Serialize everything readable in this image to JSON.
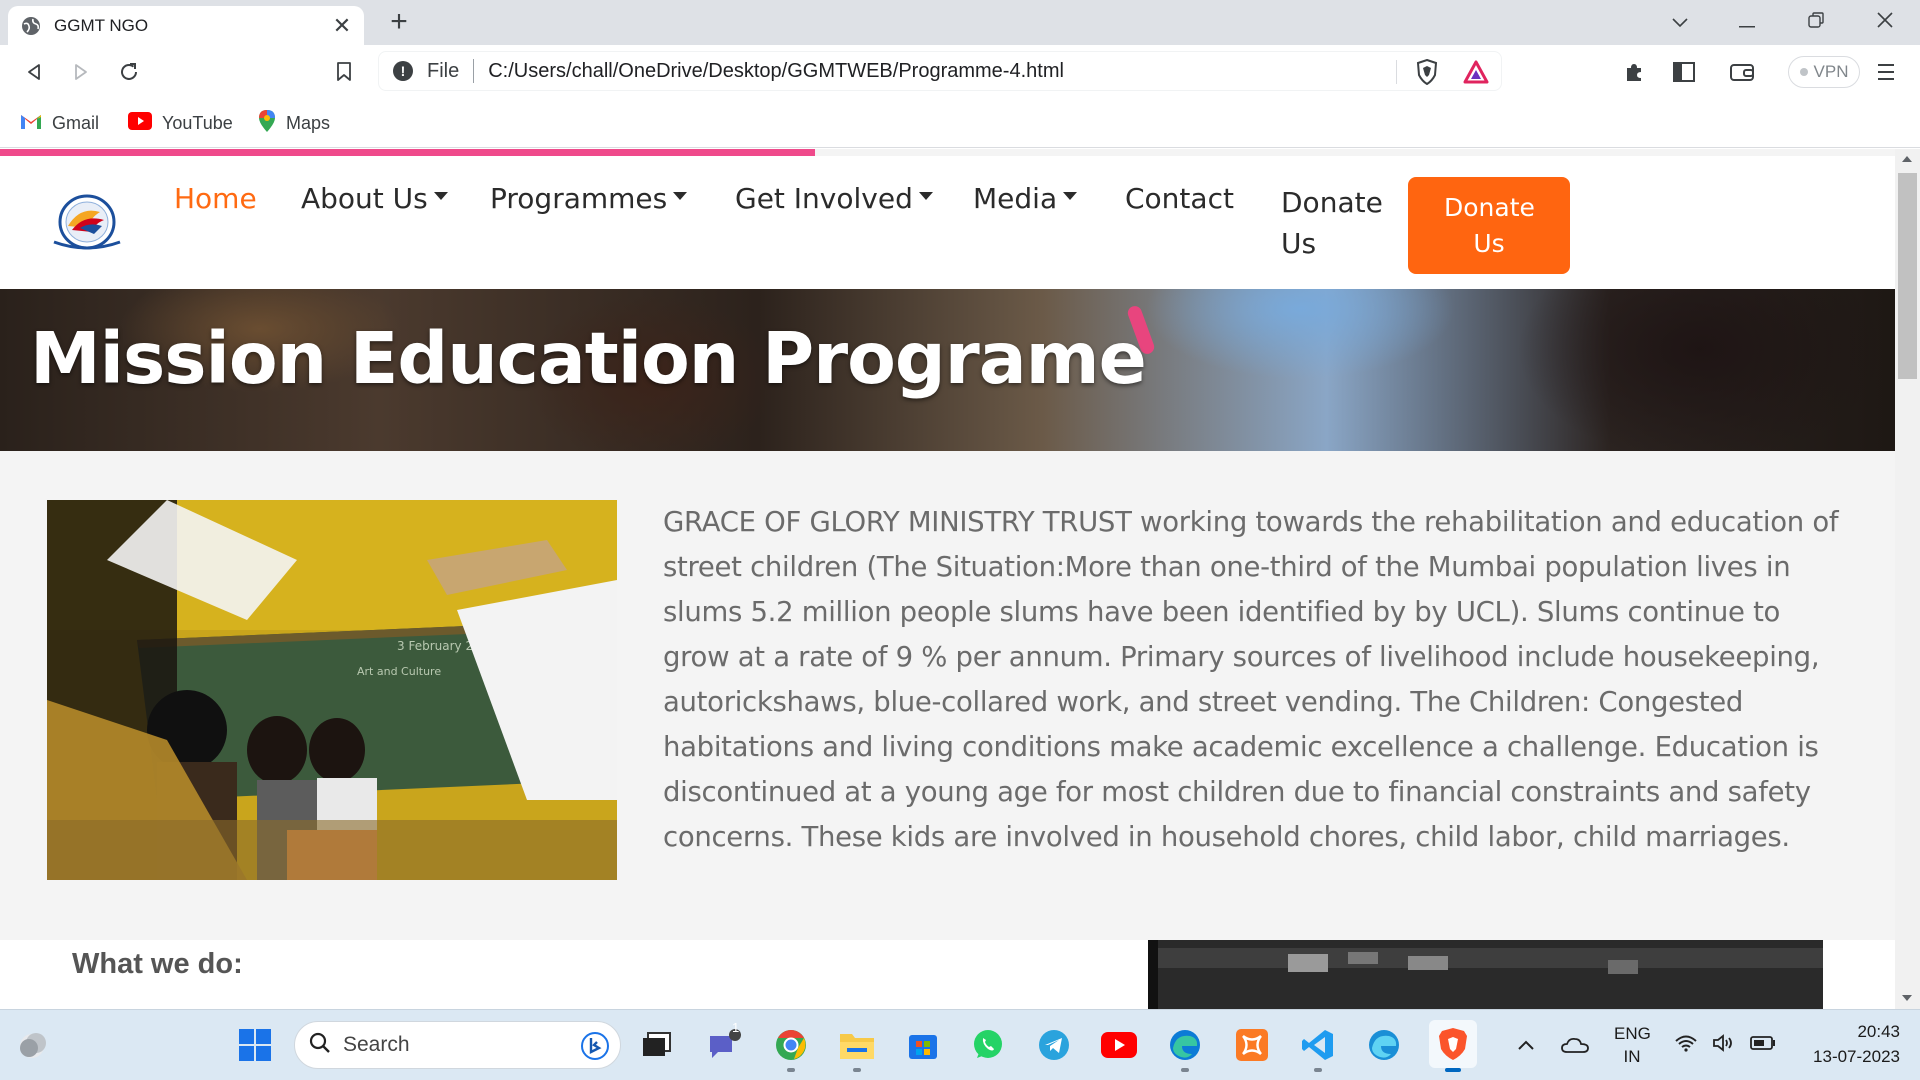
{
  "browser": {
    "tab_title": "GGMT NGO",
    "url_scheme": "File",
    "url": "C:/Users/chall/OneDrive/Desktop/GGMTWEB/Programme-4.html",
    "vpn_label": "VPN",
    "bookmarks": [
      {
        "label": "Gmail",
        "icon": "gmail-icon"
      },
      {
        "label": "YouTube",
        "icon": "youtube-icon"
      },
      {
        "label": "Maps",
        "icon": "maps-icon"
      }
    ]
  },
  "site": {
    "scroll_progress_percent": 43,
    "nav": {
      "home": "Home",
      "about": "About Us",
      "programmes": "Programmes",
      "get_involved": "Get Involved",
      "media": "Media",
      "contact": "Contact",
      "donate_text": "Donate Us",
      "donate_button": "Donate Us"
    },
    "hero_title": "Mission Education Programe",
    "body_text": "GRACE OF GLORY MINISTRY TRUST working towards the rehabilitation and education of street children (The Situation:More than one-third of the Mumbai population lives in slums 5.2 million people slums have been identified by by UCL). Slums continue to grow at a rate of 9 % per annum. Primary sources of livelihood include housekeeping, autorickshaws, blue-collared work, and street vending. The Children: Congested habitations and living conditions make academic excellence a challenge. Education is discontinued at a young age for most children due to financial constraints and safety concerns. These kids are involved in household chores, child labor, child marriages.",
    "section_heading": "What we do:"
  },
  "taskbar": {
    "search_label": "Search",
    "chat_badge": "1",
    "lang_top": "ENG",
    "lang_bottom": "IN",
    "time": "20:43",
    "date": "13-07-2023"
  },
  "colors": {
    "accent_orange": "#ff6510",
    "progress_pink": "#ef4a8b",
    "active_nav": "#ff6a12"
  }
}
